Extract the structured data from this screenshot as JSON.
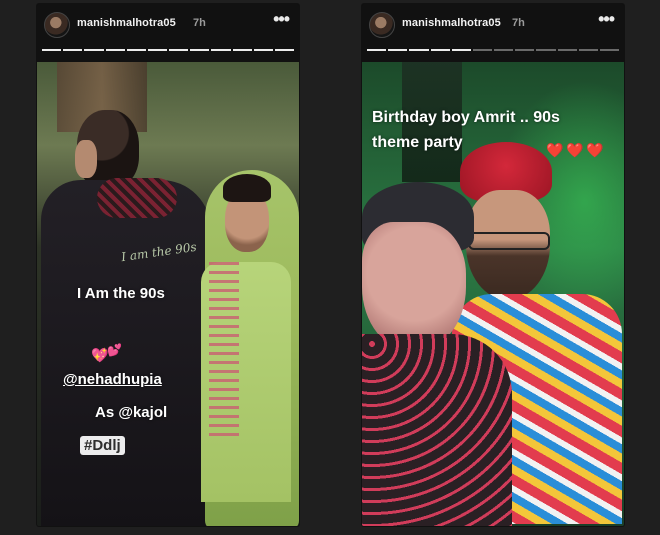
{
  "stories": [
    {
      "username": "manishmalhotra05",
      "time": "7h",
      "more_label": "•••",
      "progress": {
        "segments": 12,
        "viewed": 12
      },
      "captions": {
        "line1": "I Am the 90s",
        "mention1": "@nehadhupia",
        "line3": "As @kajol",
        "hashtag": "#Ddlj"
      },
      "jacket_text": "I am the 90s",
      "emojis": [
        "💖",
        "💕"
      ]
    },
    {
      "username": "manishmalhotra05",
      "time": "7h",
      "more_label": "•••",
      "progress": {
        "segments": 12,
        "viewed": 5
      },
      "captions": {
        "line1": "Birthday boy Amrit .. 90s",
        "line2": "theme party"
      },
      "emojis": [
        "❤️",
        "❤️",
        "❤️"
      ]
    }
  ]
}
